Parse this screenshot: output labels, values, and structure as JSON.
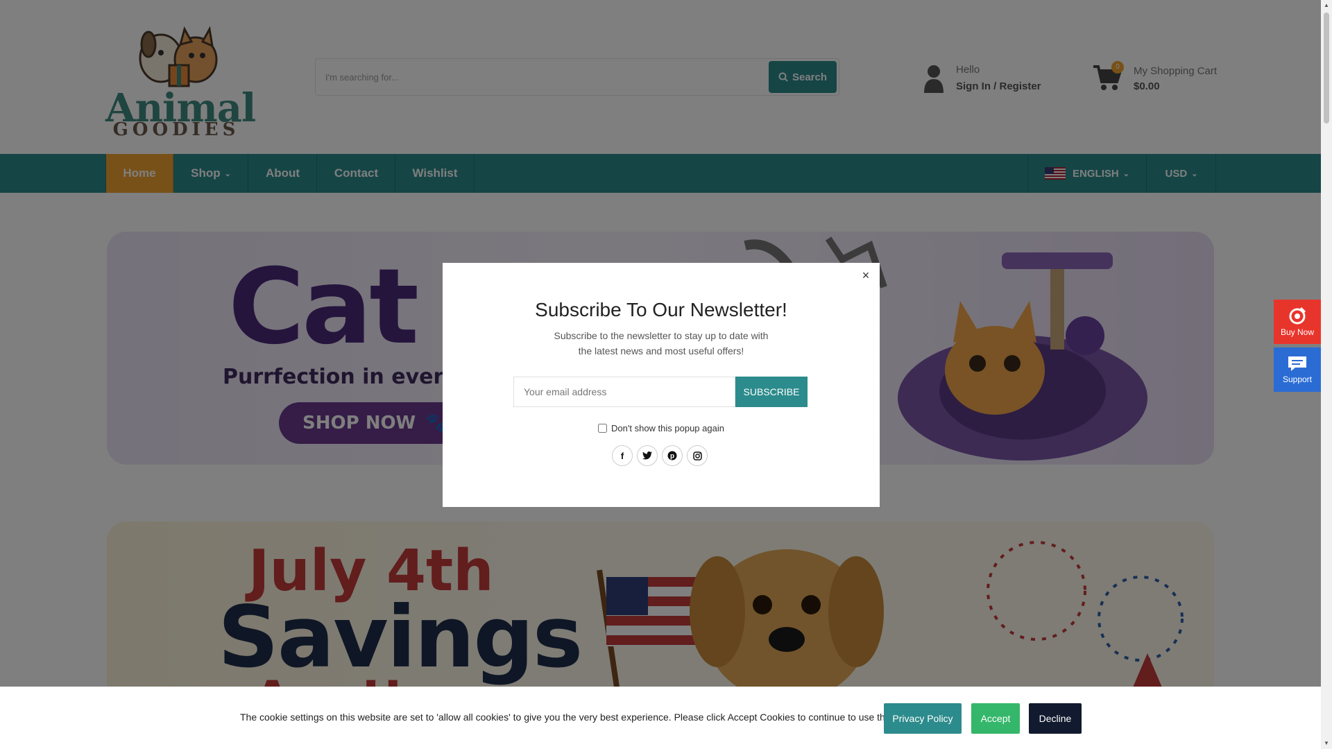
{
  "brand": {
    "logo_word": "Animal",
    "logo_sub": "GOODIES"
  },
  "search": {
    "placeholder": "I'm searching for...",
    "button_label": "Search"
  },
  "account": {
    "greeting": "Hello",
    "sign_in_label": "Sign In / Register"
  },
  "cart": {
    "count": "0",
    "title": "My Shopping Cart",
    "total": "$0.00"
  },
  "nav": {
    "items": [
      {
        "label": "Home",
        "active": true
      },
      {
        "label": "Shop",
        "has_dropdown": true
      },
      {
        "label": "About"
      },
      {
        "label": "Contact"
      },
      {
        "label": "Wishlist"
      }
    ],
    "language": "ENGLISH",
    "currency": "USD"
  },
  "banners": {
    "cat": {
      "title": "Cat",
      "subtitle": "Purrfection in every m",
      "button": "SHOP NOW"
    },
    "july": {
      "line1": "July 4th",
      "line2": "Savings",
      "line3": "Are Here"
    }
  },
  "modal": {
    "close": "×",
    "title": "Subscribe To Our Newsletter!",
    "description": "Subscribe to the newsletter to stay up to date with the latest news and most useful offers!",
    "email_placeholder": "Your email address",
    "subscribe_label": "SUBSCRIBE",
    "dont_show_label": "Don't show this popup again",
    "socials": [
      "facebook-icon",
      "twitter-icon",
      "pinterest-icon",
      "instagram-icon"
    ]
  },
  "side": {
    "buy_label": "Buy Now",
    "support_label": "Support"
  },
  "cookie": {
    "text": "The cookie settings on this website are set to 'allow all cookies' to give you the very best experience. Please click Accept Cookies to continue to use the site.",
    "privacy_label": "Privacy Policy",
    "accept_label": "Accept",
    "decline_label": "Decline"
  },
  "colors": {
    "teal": "#2c8b8c",
    "orange": "#f0a331",
    "accept_green": "#34b76a",
    "decline_navy": "#111a2e",
    "buy_red": "#e8352c",
    "support_blue": "#2b6cd4"
  }
}
